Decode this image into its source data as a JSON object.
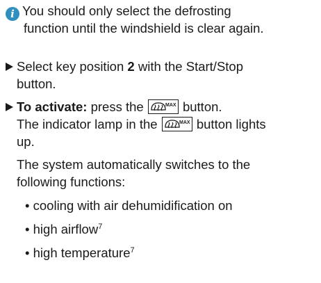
{
  "note": {
    "icon": "info-icon",
    "icon_color": "#2f8fbe",
    "line1": "You should only select the defrosting",
    "line2": "function until the windshield is clear again."
  },
  "step1": {
    "part1": "Select key position ",
    "key": "2",
    "part2": " with the Start/Stop",
    "line2": "button."
  },
  "step2": {
    "label": "To activate:",
    "part1": " press the ",
    "part2": " button.",
    "line2_a": "The indicator lamp in the ",
    "line2_b": " button lights",
    "line3": "up.",
    "para_line1": "The system automatically switches to the",
    "para_line2": "following functions:",
    "bullets": [
      {
        "text": "cooling with air dehumidification on",
        "sup": ""
      },
      {
        "text": "high airflow",
        "sup": "7"
      },
      {
        "text": "high temperature",
        "sup": "7"
      }
    ]
  },
  "icons": {
    "defrost_button": "windshield-defrost-max-icon",
    "defrost_label": "MAX"
  }
}
